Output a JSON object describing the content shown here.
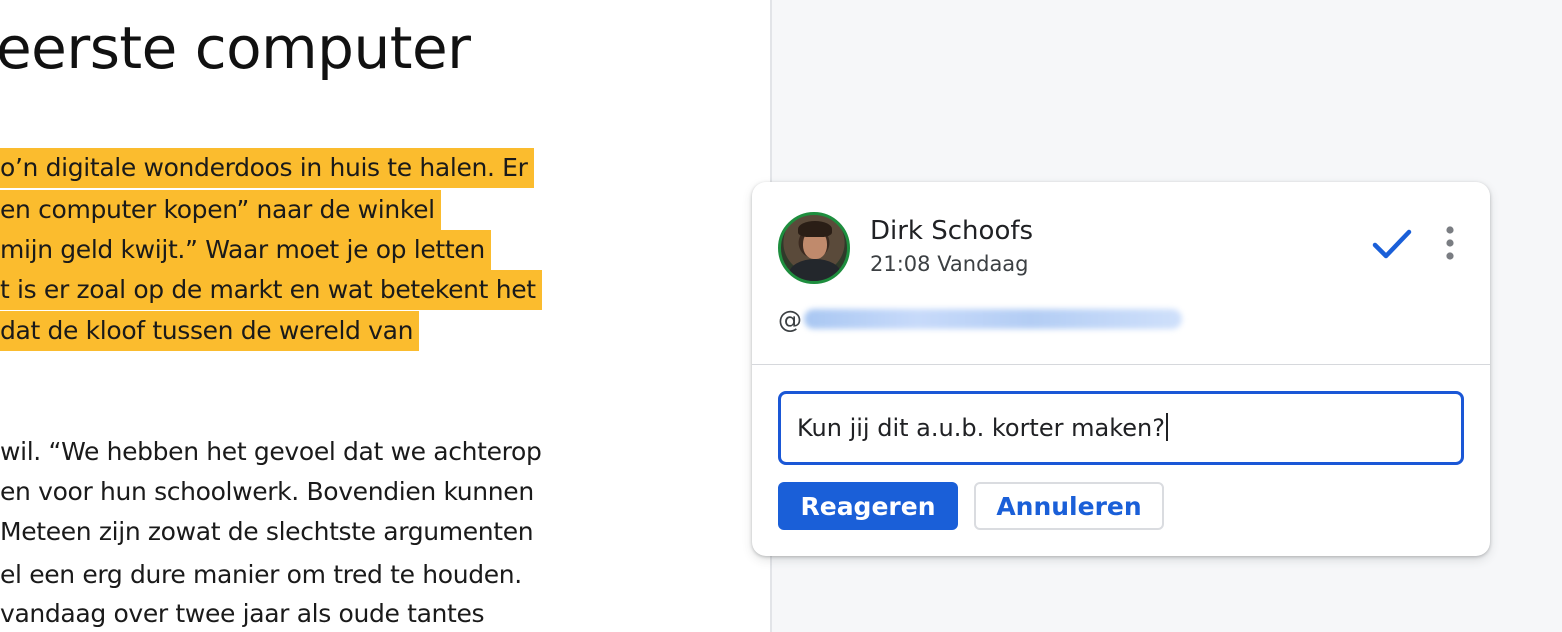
{
  "document": {
    "title": "eerste computer",
    "highlighted_lines": [
      "o’n digitale wonderdoos in huis te halen. Er",
      "en computer kopen” naar de winkel",
      "mijn geld kwijt.” Waar moet je op letten",
      "t is er zoal op de markt en wat betekent het",
      "dat de kloof tussen de wereld van"
    ],
    "body_lines": [
      "wil. “We hebben het gevoel dat we achterop",
      "en voor hun schoolwerk. Bovendien kunnen",
      "Meteen zijn zowat de slechtste argumenten",
      "el een erg dure manier om tred te houden.",
      "vandaag over twee jaar als oude tantes"
    ],
    "highlight_color": "#fbbc2e"
  },
  "comment": {
    "author": "Dirk Schoofs",
    "timestamp": "21:08 Vandaag",
    "mention_prefix": "@",
    "avatar_icon": "user-photo",
    "resolve_icon": "checkmark-icon",
    "more_icon": "more-vert-icon",
    "accent_color": "#1a5fd8"
  },
  "reply": {
    "input_value": "Kun jij dit a.u.b. korter maken?",
    "submit_label": "Reageren",
    "cancel_label": "Annuleren"
  }
}
